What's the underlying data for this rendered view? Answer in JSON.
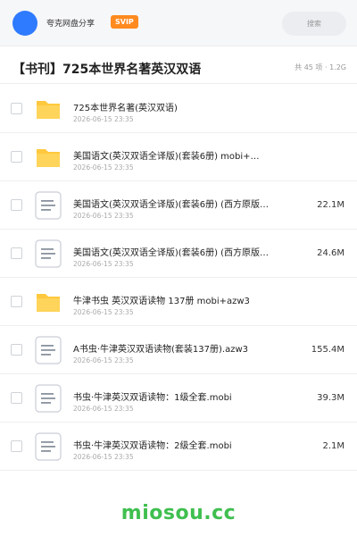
{
  "topbar": {
    "username": "夸克网盘分享",
    "badge": "SVIP",
    "search_placeholder": "搜索"
  },
  "header": {
    "title": "【书刊】725本世界名著英汉双语",
    "meta": "共 45 项 · 1.2G"
  },
  "files": [
    {
      "type": "folder",
      "name": "725本世界名著(英汉双语)",
      "date": "2026-06-15 23:35",
      "size": ""
    },
    {
      "type": "folder",
      "name": "美国语文(英汉双语全译版)(套装6册) mobi+…",
      "date": "2026-06-15 23:35",
      "size": ""
    },
    {
      "type": "file",
      "name": "美国语文(英汉双语全译版)(套装6册) (西方原版…",
      "date": "2026-06-15 23:35",
      "size": "22.1M"
    },
    {
      "type": "file",
      "name": "美国语文(英汉双语全译版)(套装6册) (西方原版…",
      "date": "2026-06-15 23:35",
      "size": "24.6M"
    },
    {
      "type": "folder",
      "name": "牛津书虫 英汉双语读物 137册 mobi+azw3",
      "date": "2026-06-15 23:35",
      "size": ""
    },
    {
      "type": "file",
      "name": "A书虫·牛津英汉双语读物(套装137册).azw3",
      "date": "2026-06-15 23:35",
      "size": "155.4M"
    },
    {
      "type": "file",
      "name": "书虫·牛津英汉双语读物：1级全套.mobi",
      "date": "2026-06-15 23:35",
      "size": "39.3M"
    },
    {
      "type": "file",
      "name": "书虫·牛津英汉双语读物：2级全套.mobi",
      "date": "2026-06-15 23:35",
      "size": "2.1M"
    }
  ],
  "watermark": "miosou.cc",
  "colors": {
    "accent": "#2f7bff",
    "svip": "#ff8a1f",
    "folder": "#ffc83d",
    "watermark": "#3fbf4f"
  }
}
